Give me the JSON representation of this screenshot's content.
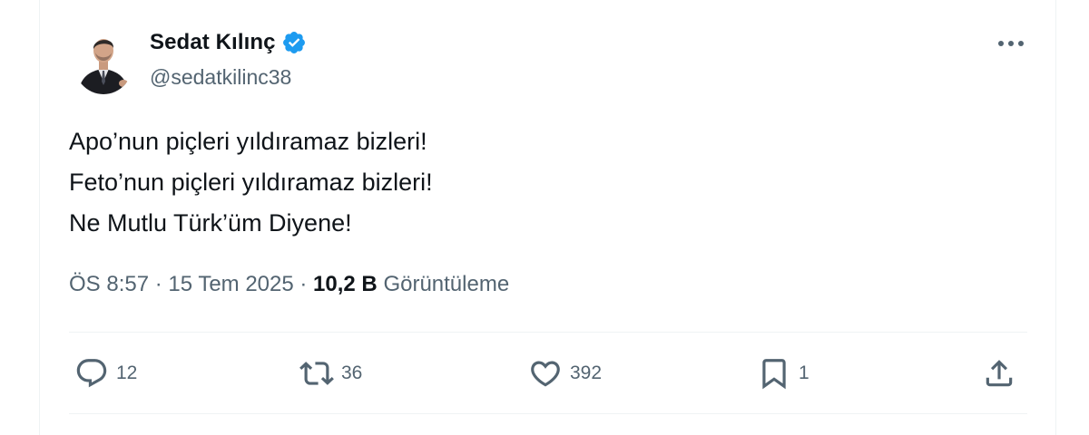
{
  "author": {
    "display_name": "Sedat Kılınç",
    "handle": "@sedatkilinc38",
    "verified": true
  },
  "tweet": {
    "lines": [
      "Apo’nun piçleri yıldıramaz bizleri!",
      "Feto’nun piçleri yıldıramaz bizleri!",
      "Ne Mutlu Türk’üm Diyene!"
    ]
  },
  "meta": {
    "time": "ÖS 8:57",
    "separator": " · ",
    "date": "15 Tem 2025",
    "views_count": "10,2 B",
    "views_label": "Görüntüleme"
  },
  "actions": {
    "replies": "12",
    "reposts": "36",
    "likes": "392",
    "bookmarks": "1"
  },
  "colors": {
    "text_primary": "#0f1419",
    "text_secondary": "#536471",
    "verified_blue": "#1d9bf0",
    "border": "#eff3f4"
  },
  "icons": [
    "verified-badge-icon",
    "more-icon",
    "reply-icon",
    "repost-icon",
    "like-icon",
    "bookmark-icon",
    "share-icon"
  ]
}
